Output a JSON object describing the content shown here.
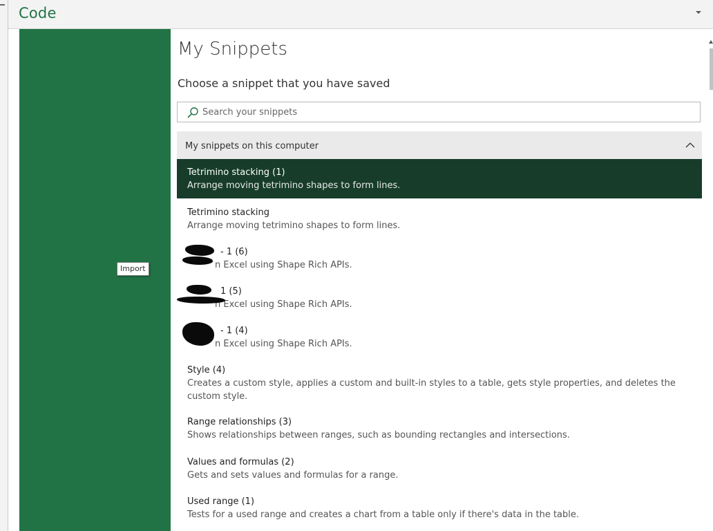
{
  "header": {
    "title": "Code",
    "menu_icon": "chevron-down-icon"
  },
  "sidebar": {
    "tooltip": "Import",
    "accent_color": "#217346"
  },
  "main": {
    "title": "My Snippets",
    "subtitle": "Choose a snippet that you have saved",
    "search": {
      "placeholder": "Search your snippets",
      "value": "",
      "icon": "search-icon"
    },
    "group": {
      "title": "My snippets on this computer",
      "toggle_icon": "chevron-up-icon"
    },
    "snippets": [
      {
        "name": "Tetrimino stacking (1)",
        "description": "Arrange moving tetrimino shapes to form lines.",
        "selected": true
      },
      {
        "name": "Tetrimino stacking",
        "description": "Arrange moving tetrimino shapes to form lines.",
        "selected": false
      },
      {
        "name": "- 1 (6)",
        "description": "n Excel using Shape Rich APIs.",
        "selected": false,
        "redacted": true
      },
      {
        "name": "1 (5)",
        "description": "n Excel using Shape Rich APIs.",
        "selected": false,
        "redacted": true
      },
      {
        "name": "- 1 (4)",
        "description": "n Excel using Shape Rich APIs.",
        "selected": false,
        "redacted": true
      },
      {
        "name": "Style (4)",
        "description": "Creates a custom style, applies a custom and built-in styles to a table, gets style properties, and deletes the custom style.",
        "selected": false
      },
      {
        "name": "Range relationships (3)",
        "description": "Shows relationships between ranges, such as bounding rectangles and intersections.",
        "selected": false
      },
      {
        "name": "Values and formulas (2)",
        "description": "Gets and sets values and formulas for a range.",
        "selected": false
      },
      {
        "name": "Used range (1)",
        "description": "Tests for a used range and creates a chart from a table only if there's data in the table.",
        "selected": false
      }
    ]
  },
  "colors": {
    "brand_green": "#217346",
    "selected_row": "#173d2a",
    "group_header_bg": "#eaeaea"
  }
}
